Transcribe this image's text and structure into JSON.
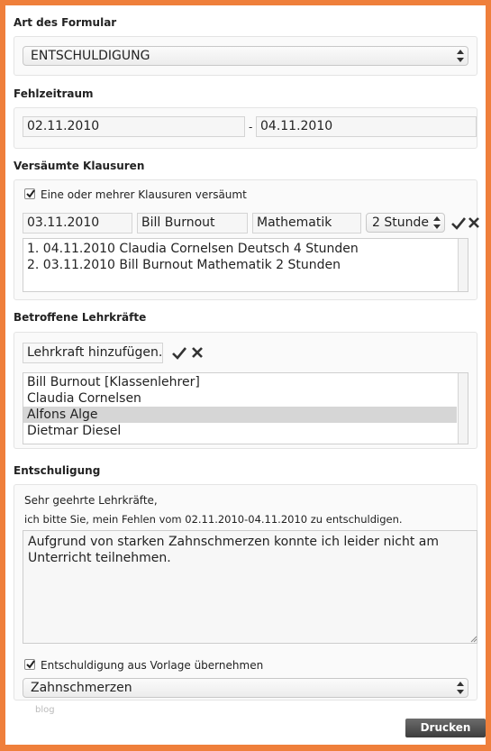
{
  "art": {
    "title": "Art des Formular",
    "selected": "ENTSCHULDIGUNG"
  },
  "fehlzeit": {
    "title": "Fehlzeitraum",
    "from": "02.11.2010",
    "separator": "-",
    "to": "04.11.2010"
  },
  "klausuren": {
    "title": "Versäumte Klausuren",
    "checkbox_label": "Eine oder mehrer Klausuren versäumt",
    "checked": true,
    "date": "03.11.2010",
    "teacher": "Bill Burnout",
    "subject": "Mathematik",
    "hours": "2 Stunde",
    "list": [
      "1. 04.11.2010 Claudia Cornelsen Deutsch 4 Stunden",
      "2. 03.11.2010 Bill Burnout Mathematik 2 Stunden"
    ]
  },
  "lehrkraefte": {
    "title": "Betroffene Lehrkräfte",
    "add_input": "Lehrkraft hinzufügen.",
    "list": [
      "Bill Burnout [Klassenlehrer]",
      "Claudia Cornelsen",
      "Alfons Alge",
      "Dietmar Diesel"
    ],
    "selected_index": 2
  },
  "entschuldigung": {
    "title": "Entschuligung",
    "greeting": "Sehr geehrte Lehrkräfte,",
    "intro": "ich bitte Sie, mein Fehlen vom 02.11.2010-04.11.2010 zu entschuldigen.",
    "text": "Aufgrund von starken Zahnschmerzen konnte ich leider nicht am Unterricht teilnehmen.",
    "template_label": "Entschuldigung aus Vorlage übernehmen",
    "template_checked": true,
    "template_selected": "Zahnschmerzen"
  },
  "footer": {
    "watermark": "blog",
    "print_label": "Drucken"
  },
  "colors": {
    "border": "#ef7f3b",
    "selected_row": "#d6d6d6",
    "print_button": "#4a4a4a"
  }
}
